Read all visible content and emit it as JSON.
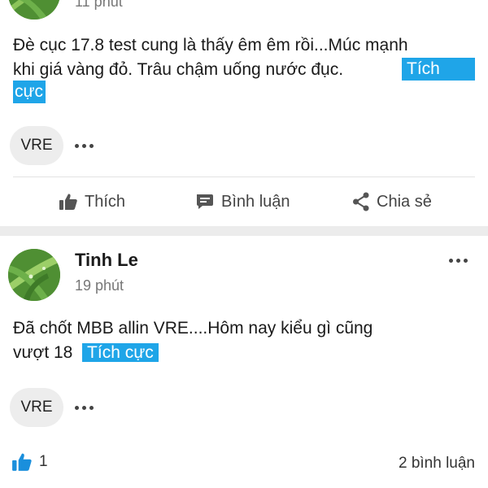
{
  "post1": {
    "time": "11 phút",
    "text_line1": "Đè cục 17.8 test cung là thấy êm êm rồi...Múc mạnh",
    "text_line2": "khi giá vàng đỏ. Trâu chậm uống nước đục.",
    "tag_part1": "Tích",
    "tag_part2": "cực",
    "ticker": "VRE"
  },
  "actions": {
    "like_label": "Thích",
    "comment_label": "Bình luận",
    "share_label": "Chia sẻ"
  },
  "post2": {
    "author": "Tinh Le",
    "time": "19 phút",
    "text_line1": "Đã chốt MBB  allin VRE....Hôm nay kiểu gì cũng",
    "text_line2": "vượt 18",
    "tag": "Tích cực",
    "ticker": "VRE",
    "like_count": "1",
    "comment_count": "2 bình luận"
  },
  "icons": {
    "like": "thumbs-up-icon",
    "comment": "comment-icon",
    "share": "share-icon",
    "more": "more-dots-icon"
  },
  "colors": {
    "tag_bg": "#1fa5e8",
    "like_blue": "#1a8fdc",
    "separator": "#ececec"
  }
}
